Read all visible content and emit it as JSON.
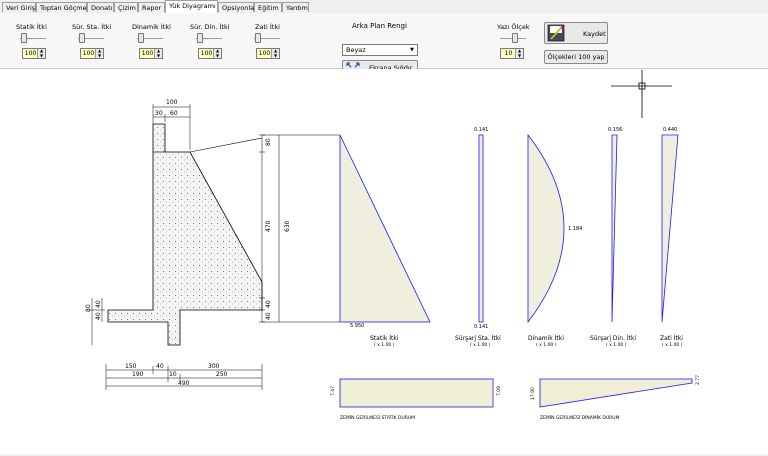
{
  "tabs": [
    "Veri Girişi",
    "Toptan Göçme",
    "Donatı",
    "Çizim",
    "Rapor",
    "Yük Diyagramı",
    "Opsiyonlar",
    "Eğitim",
    "Yardım"
  ],
  "controls": [
    {
      "label": "Statik İtki",
      "value": "100"
    },
    {
      "label": "Sür. Sta. İtki",
      "value": "100"
    },
    {
      "label": "Dinamik İtki",
      "value": "100"
    },
    {
      "label": "Sür. Din. İtki",
      "value": "100"
    },
    {
      "label": "Zati İtki",
      "value": "100"
    }
  ],
  "background": {
    "label": "Arka Plan Rengi",
    "selected": "Beyaz"
  },
  "fit_button": "Ekrana Sığdır",
  "font_scale": {
    "label": "Yazı Ölçek",
    "value": "10"
  },
  "save_button": "Kaydet",
  "scale100_button": "Ölçekleri 100 yap",
  "wall_dims": {
    "top": "100",
    "top_left": "30",
    "top_right": "60",
    "right_top": "80",
    "right_mid": "470",
    "right_total": "630",
    "right_b1": "40",
    "right_b2": "40",
    "left_a": "40",
    "left_b": "40",
    "left_c": "80",
    "bottom_150": "150",
    "bottom_40": "40",
    "bottom_300": "300",
    "bottom_190": "190",
    "bottom_10": "10",
    "bottom_250": "250",
    "bottom_total": "490"
  },
  "diagrams": [
    {
      "name": "Statik İtki",
      "scale": "( x 1.00 )",
      "top": "",
      "bottom": "5.950",
      "mid": ""
    },
    {
      "name": "Sürşarj Sta. İtki",
      "scale": "( x 1.00 )",
      "top": "0.141",
      "bottom": "0.141",
      "mid": ""
    },
    {
      "name": "Dinamik İtki",
      "scale": "( x 1.00 )",
      "top": "",
      "bottom": "",
      "mid": "1.184"
    },
    {
      "name": "Sürşarj Din. İtki",
      "scale": "( x 1.00 )",
      "top": "0.156",
      "bottom": "",
      "mid": ""
    },
    {
      "name": "Zati İtki",
      "scale": "( x 1.00 )",
      "top": "0.440",
      "bottom": "",
      "mid": ""
    }
  ],
  "soil": [
    {
      "label": "ZEMİN GERİLMESİ STATİK DURUM",
      "left": "7.47",
      "right": "7.08"
    },
    {
      "label": "ZEMİN GERİLMESİ DİNAMİK DURUM",
      "left": "17.90",
      "right": "2.77"
    }
  ],
  "colors": {
    "diagram_line": "#1a1aff",
    "hatch": "#d8d2a0",
    "concrete": "#f2f2f2"
  }
}
